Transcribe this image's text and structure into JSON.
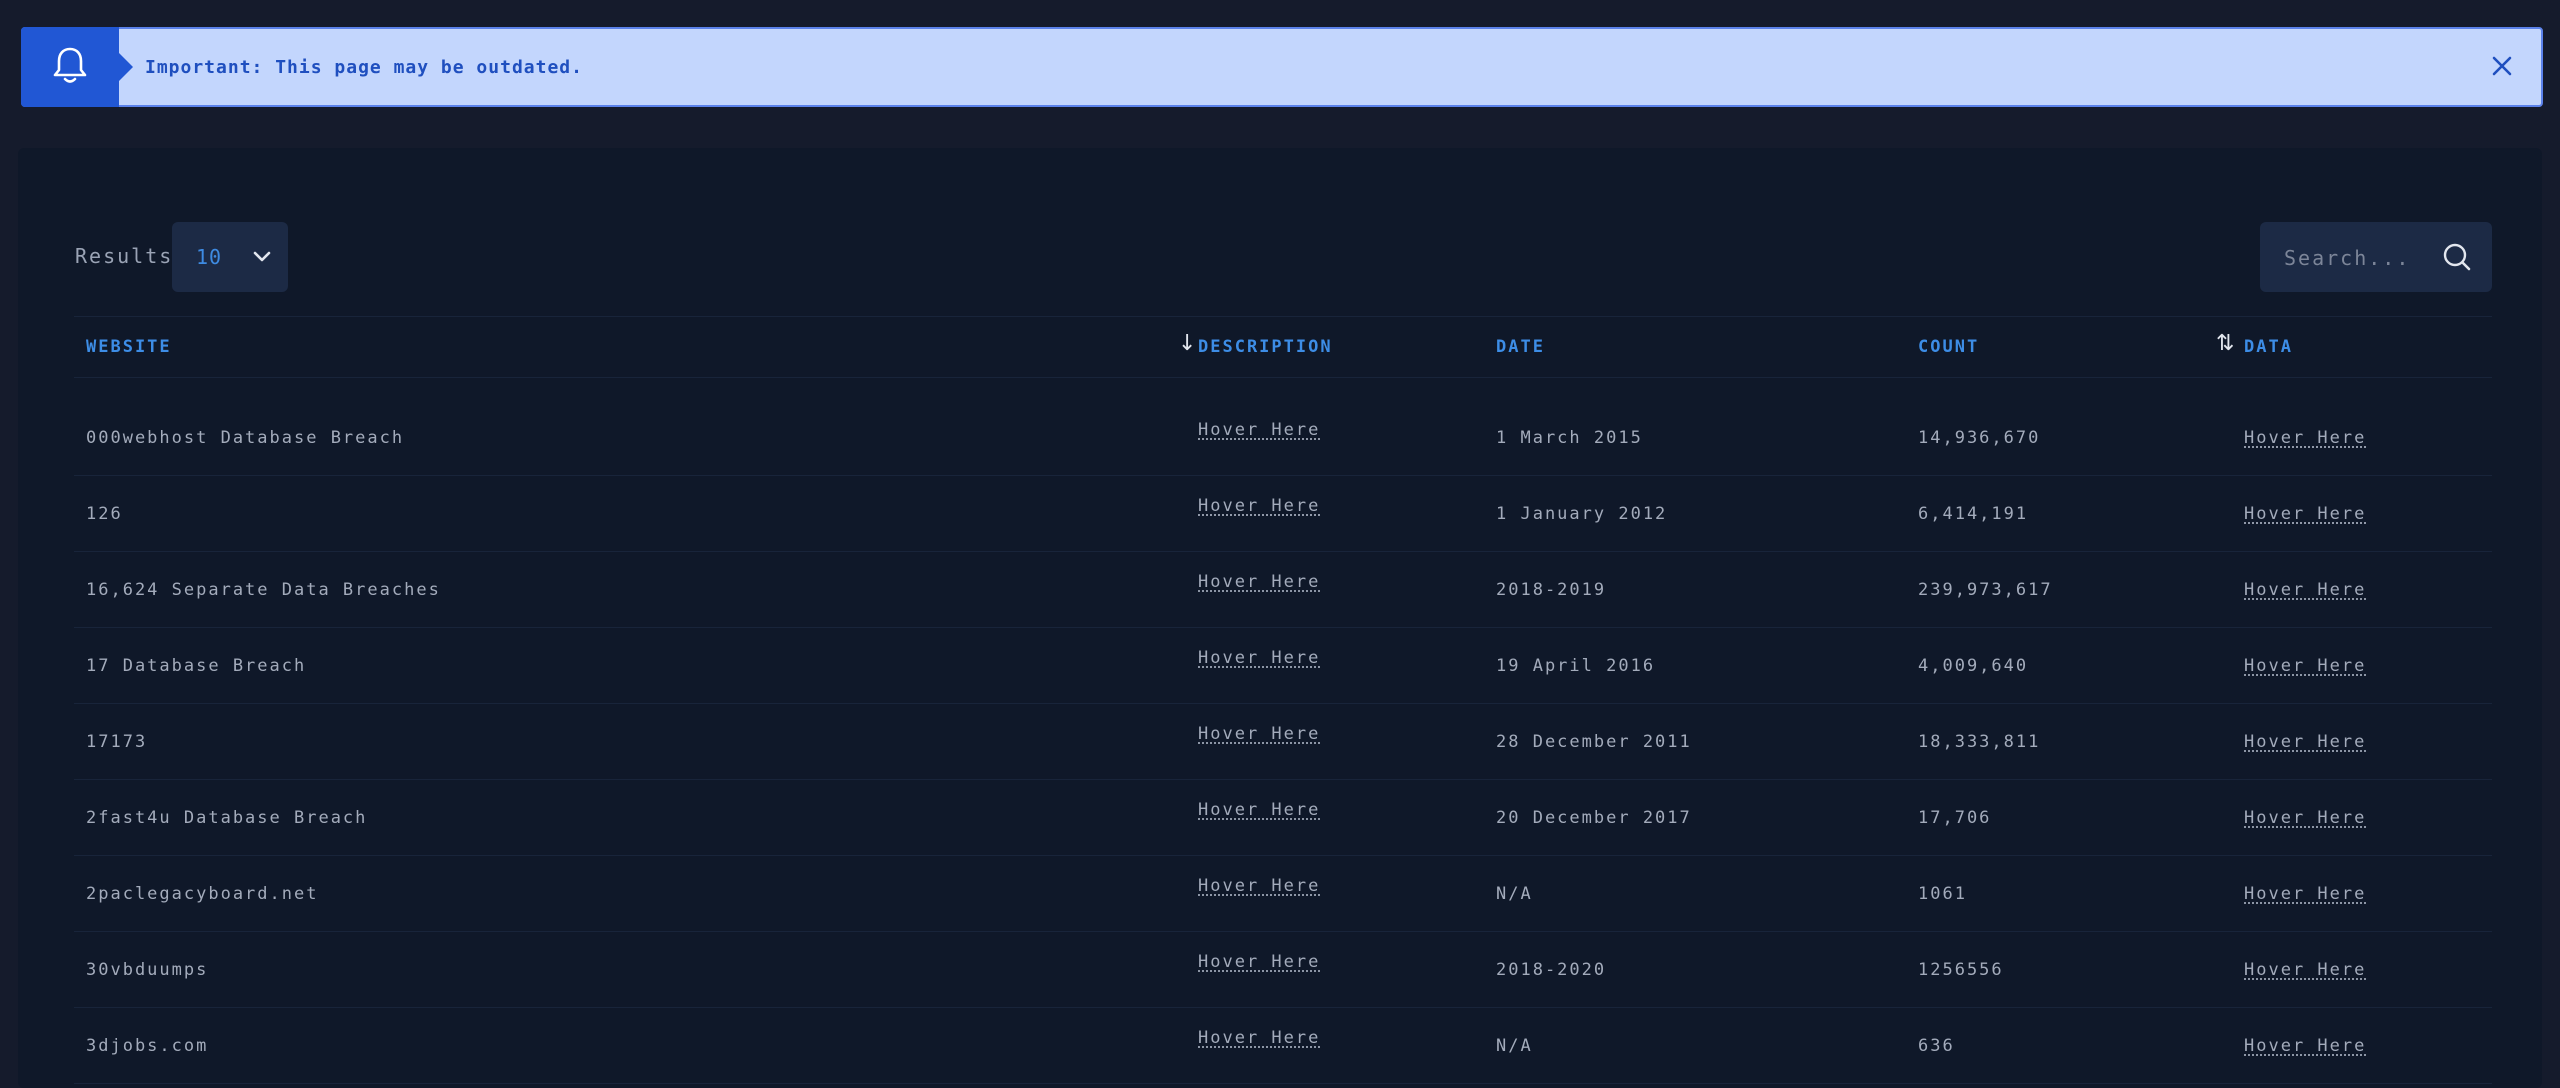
{
  "banner": {
    "icon": "bell-icon",
    "text": "Important: This page may be outdated.",
    "close_icon": "close-icon"
  },
  "controls": {
    "results_label": "Results:",
    "results_value": "10",
    "search_placeholder": "Search..."
  },
  "table": {
    "columns": [
      {
        "label": "WEBSITE",
        "sort_icon": "sort-down-icon"
      },
      {
        "label": "DESCRIPTION"
      },
      {
        "label": "DATE"
      },
      {
        "label": "COUNT",
        "sort_icon": "sort-both-icon"
      },
      {
        "label": "DATA"
      }
    ],
    "rows": [
      {
        "website": "000webhost Database Breach",
        "description": "Hover Here",
        "date": "1 March 2015",
        "count": "14,936,670",
        "data": "Hover Here"
      },
      {
        "website": "126",
        "description": "Hover Here",
        "date": "1 January 2012",
        "count": "6,414,191",
        "data": "Hover Here"
      },
      {
        "website": "16,624 Separate Data Breaches",
        "description": "Hover Here",
        "date": "2018-2019",
        "count": "239,973,617",
        "data": "Hover Here"
      },
      {
        "website": "17 Database Breach",
        "description": "Hover Here",
        "date": "19 April 2016",
        "count": "4,009,640",
        "data": "Hover Here"
      },
      {
        "website": "17173",
        "description": "Hover Here",
        "date": "28 December 2011",
        "count": "18,333,811",
        "data": "Hover Here"
      },
      {
        "website": "2fast4u Database Breach",
        "description": "Hover Here",
        "date": "20 December 2017",
        "count": "17,706",
        "data": "Hover Here"
      },
      {
        "website": "2paclegacyboard.net",
        "description": "Hover Here",
        "date": "N/A",
        "count": "1061",
        "data": "Hover Here"
      },
      {
        "website": "30vbduumps",
        "description": "Hover Here",
        "date": "2018-2020",
        "count": "1256556",
        "data": "Hover Here"
      },
      {
        "website": "3djobs.com",
        "description": "Hover Here",
        "date": "N/A",
        "count": "636",
        "data": "Hover Here"
      }
    ]
  },
  "colors": {
    "background": "#151b2c",
    "panel": "#0f1829",
    "accent": "#3d8de6",
    "banner_bg": "#c3d6fd",
    "banner_icon_bg": "#2157d4"
  }
}
